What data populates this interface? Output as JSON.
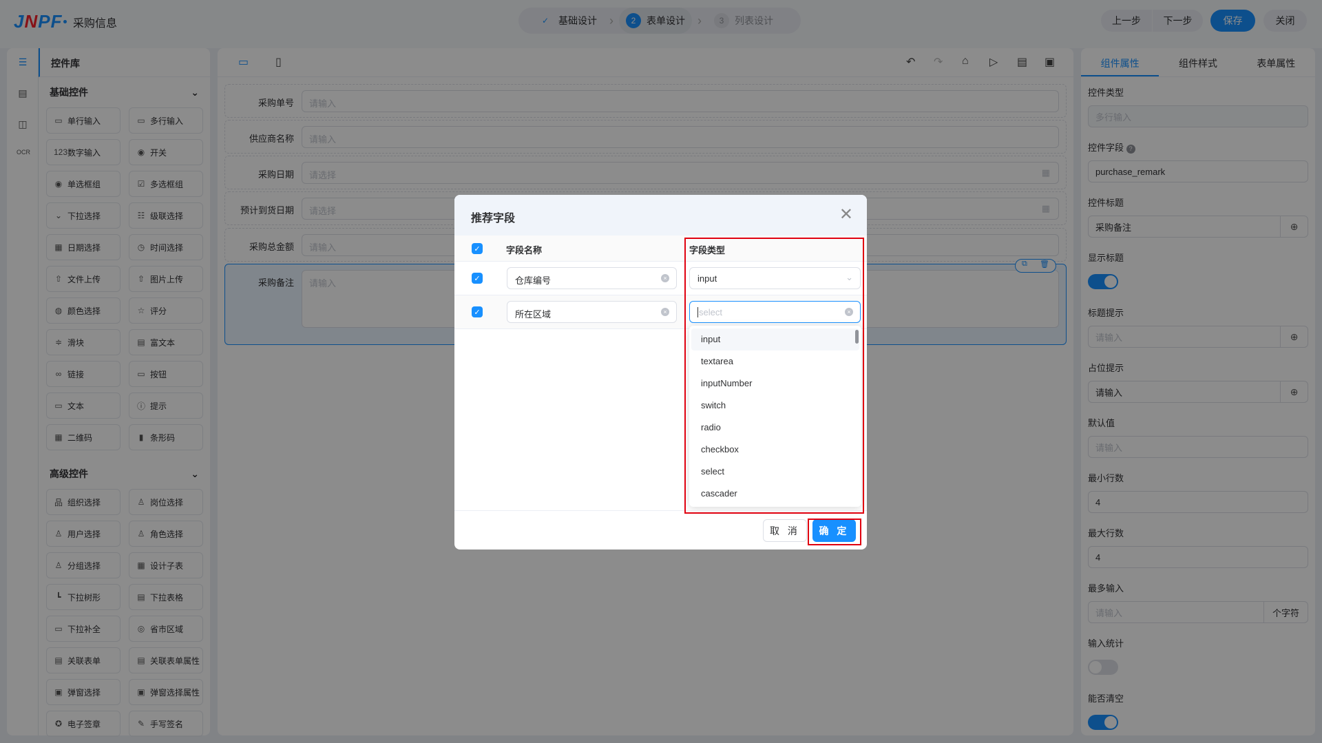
{
  "header": {
    "logo": "JNPF",
    "title": "采购信息",
    "steps": [
      {
        "num": "✓",
        "label": "基础设计",
        "state": "done"
      },
      {
        "num": "2",
        "label": "表单设计",
        "state": "active"
      },
      {
        "num": "3",
        "label": "列表设计",
        "state": "todo"
      }
    ],
    "buttons": {
      "prev": "上一步",
      "next": "下一步",
      "save": "保存",
      "close": "关闭"
    }
  },
  "library": {
    "title": "控件库",
    "basic_title": "基础控件",
    "basic": [
      {
        "label": "单行输入",
        "icon": "▭"
      },
      {
        "label": "多行输入",
        "icon": "▭"
      },
      {
        "label": "数字输入",
        "icon": "123"
      },
      {
        "label": "开关",
        "icon": "◉"
      },
      {
        "label": "单选框组",
        "icon": "◉"
      },
      {
        "label": "多选框组",
        "icon": "☑"
      },
      {
        "label": "下拉选择",
        "icon": "⌄"
      },
      {
        "label": "级联选择",
        "icon": "☷"
      },
      {
        "label": "日期选择",
        "icon": "▦"
      },
      {
        "label": "时间选择",
        "icon": "◷"
      },
      {
        "label": "文件上传",
        "icon": "⇧"
      },
      {
        "label": "图片上传",
        "icon": "⇧"
      },
      {
        "label": "颜色选择",
        "icon": "◍"
      },
      {
        "label": "评分",
        "icon": "☆"
      },
      {
        "label": "滑块",
        "icon": "≑"
      },
      {
        "label": "富文本",
        "icon": "▤"
      },
      {
        "label": "链接",
        "icon": "∞"
      },
      {
        "label": "按钮",
        "icon": "▭"
      },
      {
        "label": "文本",
        "icon": "▭"
      },
      {
        "label": "提示",
        "icon": "ⓘ"
      },
      {
        "label": "二维码",
        "icon": "▦"
      },
      {
        "label": "条形码",
        "icon": "▮"
      }
    ],
    "advanced_title": "高级控件",
    "advanced": [
      {
        "label": "组织选择",
        "icon": "品"
      },
      {
        "label": "岗位选择",
        "icon": "♙"
      },
      {
        "label": "用户选择",
        "icon": "♙"
      },
      {
        "label": "角色选择",
        "icon": "♙"
      },
      {
        "label": "分组选择",
        "icon": "♙"
      },
      {
        "label": "设计子表",
        "icon": "▦"
      },
      {
        "label": "下拉树形",
        "icon": "┗"
      },
      {
        "label": "下拉表格",
        "icon": "▤"
      },
      {
        "label": "下拉补全",
        "icon": "▭"
      },
      {
        "label": "省市区域",
        "icon": "◎"
      },
      {
        "label": "关联表单",
        "icon": "▤"
      },
      {
        "label": "关联表单属性",
        "icon": "▤"
      },
      {
        "label": "弹窗选择",
        "icon": "▣"
      },
      {
        "label": "弹窗选择属性",
        "icon": "▣"
      },
      {
        "label": "电子签章",
        "icon": "✪"
      },
      {
        "label": "手写签名",
        "icon": "✎"
      }
    ]
  },
  "form": {
    "fields": [
      {
        "label": "采购单号",
        "placeholder": "请输入"
      },
      {
        "label": "供应商名称",
        "placeholder": "请输入"
      },
      {
        "label": "采购日期",
        "placeholder": "请选择"
      },
      {
        "label": "预计到货日期",
        "placeholder": "请选择"
      },
      {
        "label": "采购总金额",
        "placeholder": "请输入"
      },
      {
        "label": "采购备注",
        "placeholder": "请输入"
      }
    ]
  },
  "props": {
    "tabs": [
      "组件属性",
      "组件样式",
      "表单属性"
    ],
    "type_label": "控件类型",
    "type_value": "多行输入",
    "field_label": "控件字段",
    "field_value": "purchase_remark",
    "title_label": "控件标题",
    "title_value": "采购备注",
    "show_title_label": "显示标题",
    "show_title": true,
    "tip_label": "标题提示",
    "tip_placeholder": "请输入",
    "ph_label": "占位提示",
    "ph_value": "请输入",
    "default_label": "默认值",
    "default_placeholder": "请输入",
    "min_rows_label": "最小行数",
    "min_rows": "4",
    "max_rows_label": "最大行数",
    "max_rows": "4",
    "max_len_label": "最多输入",
    "max_len_placeholder": "请输入",
    "max_len_unit": "个字符",
    "count_label": "输入统计",
    "count": false,
    "clear_label": "能否清空",
    "clear": true
  },
  "modal": {
    "title": "推荐字段",
    "col_name": "字段名称",
    "col_type": "字段类型",
    "rows": [
      {
        "name": "仓库编号",
        "type": "input"
      },
      {
        "name": "所在区域",
        "type": "",
        "type_placeholder": "select"
      }
    ],
    "options": [
      "input",
      "textarea",
      "inputNumber",
      "switch",
      "radio",
      "checkbox",
      "select",
      "cascader"
    ],
    "cancel": "取 消",
    "confirm": "确 定"
  },
  "colors": {
    "primary": "#1890ff",
    "highlight": "#e0000f"
  }
}
